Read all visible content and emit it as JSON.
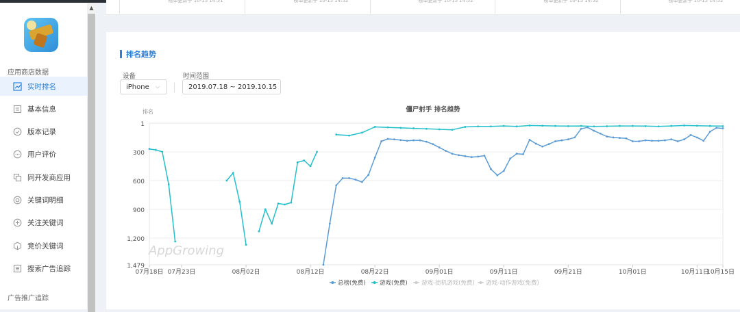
{
  "sidebar": {
    "section_store": "应用商店数据",
    "section_ads": "广告推广追踪",
    "items": [
      {
        "label": "实时排名",
        "active": true,
        "icon": "chart-icon"
      },
      {
        "label": "基本信息",
        "active": false,
        "icon": "doc-icon"
      },
      {
        "label": "版本记录",
        "active": false,
        "icon": "check-circle-icon"
      },
      {
        "label": "用户评价",
        "active": false,
        "icon": "comment-icon"
      },
      {
        "label": "同开发商应用",
        "active": false,
        "icon": "copy-icon"
      },
      {
        "label": "关键词明细",
        "active": false,
        "icon": "target-icon"
      },
      {
        "label": "关注关键词",
        "active": false,
        "icon": "plus-circle-icon"
      },
      {
        "label": "竞价关键词",
        "active": false,
        "icon": "box-icon"
      },
      {
        "label": "搜索广告追踪",
        "active": false,
        "icon": "list-icon"
      }
    ]
  },
  "top_panel": {
    "cells": [
      "榜单更新于 10-15 14:51",
      "榜单更新于 10-15 14:52",
      "榜单更新于 10-15 14:52",
      "榜单更新于 10-15 14:52",
      "榜单更新于 10-15 14:52"
    ]
  },
  "section": {
    "title": "排名趋势",
    "device_label": "设备",
    "device_value": "iPhone",
    "range_label": "时间范围",
    "range_value": "2019.07.18 ~ 2019.10.15"
  },
  "colors": {
    "accent": "#2b7fd6",
    "series_total": "#5b9bd5",
    "series_games": "#22bfcc",
    "series_disabled": "#cccccc"
  },
  "chart_data": {
    "type": "line",
    "title": "僵尸射手 排名趋势",
    "ylabel": "排名",
    "y_inverted": true,
    "ylim": [
      1,
      1479
    ],
    "y_ticks": [
      1,
      300,
      600,
      900,
      1200,
      1479
    ],
    "y_tick_labels": [
      "1",
      "300",
      "600",
      "900",
      "1,200",
      "1,479"
    ],
    "x_range": [
      "2019-07-18",
      "2019-10-15"
    ],
    "x_ticks": [
      "2019-07-18",
      "2019-07-23",
      "2019-08-02",
      "2019-08-12",
      "2019-08-22",
      "2019-09-01",
      "2019-09-11",
      "2019-09-21",
      "2019-10-01",
      "2019-10-11",
      "2019-10-15"
    ],
    "x_tick_labels": [
      "07月18日",
      "07月23日",
      "08月02日",
      "08月12日",
      "08月22日",
      "09月01日",
      "09月11日",
      "09月21日",
      "10月01日",
      "10月11日",
      "10月15日"
    ],
    "watermark": "AppGrowing",
    "legend": {
      "placement": "bottom",
      "entries": [
        {
          "name": "总榜(免费)",
          "active": true
        },
        {
          "name": "游戏(免费)",
          "active": true
        },
        {
          "name": "游戏-街机游戏(免费)",
          "active": false
        },
        {
          "name": "游戏-动作游戏(免费)",
          "active": false
        }
      ]
    },
    "series": [
      {
        "name": "总榜(免费)",
        "color": "#5b9bd5",
        "segments": [
          [
            [
              "2019-08-14",
              1479
            ],
            [
              "2019-08-15",
              1050
            ],
            [
              "2019-08-16",
              650
            ],
            [
              "2019-08-17",
              575
            ],
            [
              "2019-08-18",
              575
            ],
            [
              "2019-08-19",
              590
            ],
            [
              "2019-08-20",
              615
            ],
            [
              "2019-08-21",
              540
            ],
            [
              "2019-08-22",
              360
            ],
            [
              "2019-08-23",
              190
            ],
            [
              "2019-08-24",
              165
            ],
            [
              "2019-08-25",
              170
            ],
            [
              "2019-08-26",
              178
            ],
            [
              "2019-08-27",
              185
            ],
            [
              "2019-08-28",
              180
            ],
            [
              "2019-08-29",
              180
            ],
            [
              "2019-08-30",
              195
            ],
            [
              "2019-08-31",
              220
            ],
            [
              "2019-09-01",
              255
            ],
            [
              "2019-09-02",
              290
            ],
            [
              "2019-09-03",
              320
            ],
            [
              "2019-09-04",
              335
            ],
            [
              "2019-09-05",
              345
            ],
            [
              "2019-09-06",
              355
            ],
            [
              "2019-09-07",
              350
            ],
            [
              "2019-09-08",
              340
            ],
            [
              "2019-09-09",
              480
            ],
            [
              "2019-09-10",
              545
            ],
            [
              "2019-09-11",
              500
            ],
            [
              "2019-09-12",
              370
            ],
            [
              "2019-09-13",
              320
            ],
            [
              "2019-09-14",
              325
            ],
            [
              "2019-09-15",
              175
            ],
            [
              "2019-09-16",
              215
            ],
            [
              "2019-09-17",
              245
            ],
            [
              "2019-09-18",
              220
            ],
            [
              "2019-09-19",
              190
            ],
            [
              "2019-09-20",
              180
            ],
            [
              "2019-09-21",
              170
            ],
            [
              "2019-09-22",
              150
            ],
            [
              "2019-09-23",
              60
            ],
            [
              "2019-09-24",
              45
            ],
            [
              "2019-09-25",
              80
            ],
            [
              "2019-09-26",
              110
            ],
            [
              "2019-09-27",
              140
            ],
            [
              "2019-09-28",
              150
            ],
            [
              "2019-09-29",
              155
            ],
            [
              "2019-09-30",
              160
            ],
            [
              "2019-10-01",
              190
            ],
            [
              "2019-10-02",
              190
            ],
            [
              "2019-10-03",
              180
            ],
            [
              "2019-10-04",
              185
            ],
            [
              "2019-10-05",
              185
            ],
            [
              "2019-10-06",
              180
            ],
            [
              "2019-10-07",
              170
            ],
            [
              "2019-10-08",
              190
            ],
            [
              "2019-10-09",
              170
            ],
            [
              "2019-10-10",
              125
            ],
            [
              "2019-10-11",
              150
            ],
            [
              "2019-10-12",
              185
            ],
            [
              "2019-10-13",
              90
            ],
            [
              "2019-10-14",
              50
            ],
            [
              "2019-10-15",
              55
            ]
          ]
        ]
      },
      {
        "name": "游戏(免费)",
        "color": "#22bfcc",
        "segments": [
          [
            [
              "2019-07-18",
              270
            ],
            [
              "2019-07-19",
              280
            ],
            [
              "2019-07-20",
              300
            ],
            [
              "2019-07-21",
              640
            ],
            [
              "2019-07-22",
              1235
            ]
          ],
          [
            [
              "2019-07-30",
              600
            ],
            [
              "2019-07-31",
              520
            ],
            [
              "2019-08-01",
              820
            ],
            [
              "2019-08-02",
              1270
            ]
          ],
          [
            [
              "2019-08-04",
              1130
            ],
            [
              "2019-08-05",
              900
            ],
            [
              "2019-08-06",
              1050
            ],
            [
              "2019-08-07",
              840
            ],
            [
              "2019-08-08",
              850
            ],
            [
              "2019-08-09",
              830
            ],
            [
              "2019-08-10",
              410
            ],
            [
              "2019-08-11",
              390
            ],
            [
              "2019-08-12",
              450
            ],
            [
              "2019-08-13",
              300
            ]
          ],
          [
            [
              "2019-08-16",
              120
            ],
            [
              "2019-08-18",
              130
            ],
            [
              "2019-08-20",
              100
            ],
            [
              "2019-08-22",
              40
            ],
            [
              "2019-08-24",
              45
            ],
            [
              "2019-08-26",
              50
            ],
            [
              "2019-08-28",
              55
            ],
            [
              "2019-08-30",
              60
            ],
            [
              "2019-09-01",
              65
            ],
            [
              "2019-09-03",
              70
            ],
            [
              "2019-09-05",
              40
            ],
            [
              "2019-09-07",
              35
            ],
            [
              "2019-09-09",
              35
            ],
            [
              "2019-09-11",
              30
            ],
            [
              "2019-09-13",
              35
            ],
            [
              "2019-09-15",
              25
            ],
            [
              "2019-09-17",
              28
            ],
            [
              "2019-09-19",
              30
            ],
            [
              "2019-09-21",
              32
            ],
            [
              "2019-09-23",
              30
            ],
            [
              "2019-09-25",
              35
            ],
            [
              "2019-09-27",
              33
            ],
            [
              "2019-09-29",
              30
            ],
            [
              "2019-10-01",
              30
            ],
            [
              "2019-10-03",
              32
            ],
            [
              "2019-10-05",
              35
            ],
            [
              "2019-10-07",
              30
            ],
            [
              "2019-10-09",
              25
            ],
            [
              "2019-10-11",
              28
            ],
            [
              "2019-10-13",
              30
            ],
            [
              "2019-10-15",
              32
            ]
          ]
        ]
      }
    ]
  }
}
